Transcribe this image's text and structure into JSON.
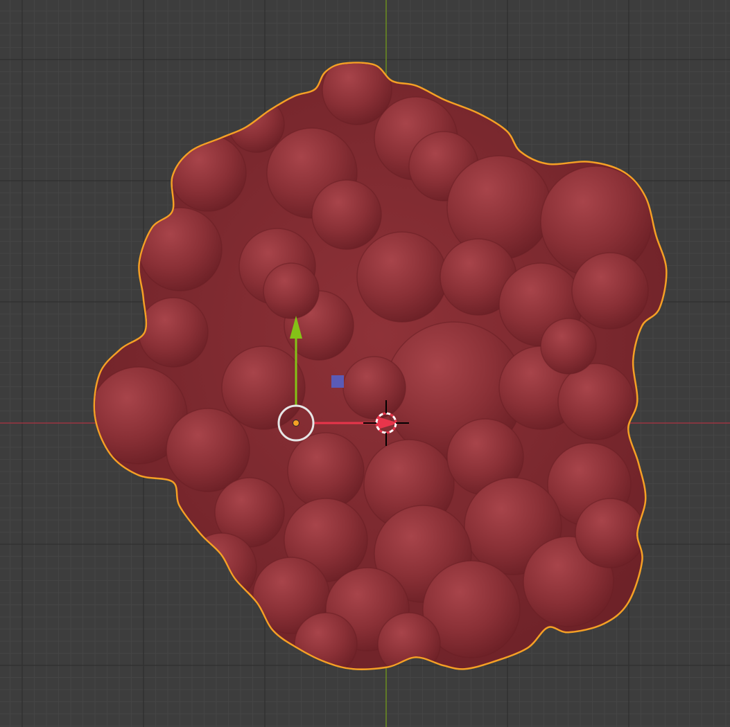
{
  "viewport": {
    "background_color": "#3d3d3d",
    "grid_minor_color": "#454545",
    "grid_major_color": "#303030",
    "x_axis_color": "#9b3442",
    "y_axis_color": "#6c8f20",
    "view_mode": "top-orthographic",
    "shading": "solid"
  },
  "object": {
    "type": "mesh",
    "appearance": "lumpy-blob",
    "selected": true,
    "active": true,
    "base_color": "#8a3036",
    "shadow_color": "#6a1f25",
    "highlight_color": "#b04a50",
    "outline_color": "#f5a025"
  },
  "gizmo": {
    "type": "move",
    "x_axis_color": "#e8354b",
    "y_axis_color": "#84c217",
    "plane_handle_color": "#5560c4",
    "pivot_color": "#f5a025",
    "ring_color": "#e6e6e6"
  },
  "cursor_3d": {
    "ring_color_a": "#e8354b",
    "ring_color_b": "#ffffff",
    "crosshair_color": "#000000"
  }
}
